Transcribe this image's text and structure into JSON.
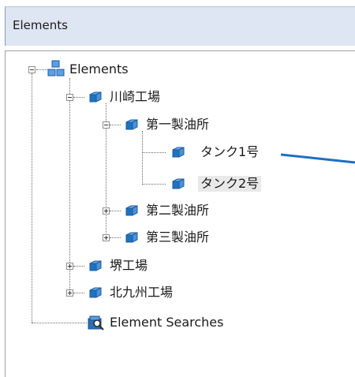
{
  "panel": {
    "title": "Elements"
  },
  "tree": {
    "root": "Elements",
    "site1": "川崎工場",
    "plant1": "第一製油所",
    "tank1": "タンク1号",
    "tank2": "タンク2号",
    "plant2": "第二製油所",
    "plant3": "第三製油所",
    "site2": "堺工場",
    "site3": "北九州工場",
    "searches": "Element Searches"
  },
  "colors": {
    "header_bg": "#dde6f2",
    "icon_blue": "#1e73be",
    "annotation_arrow": "#1f6fc0",
    "selection_bg": "#e9e9e9"
  }
}
